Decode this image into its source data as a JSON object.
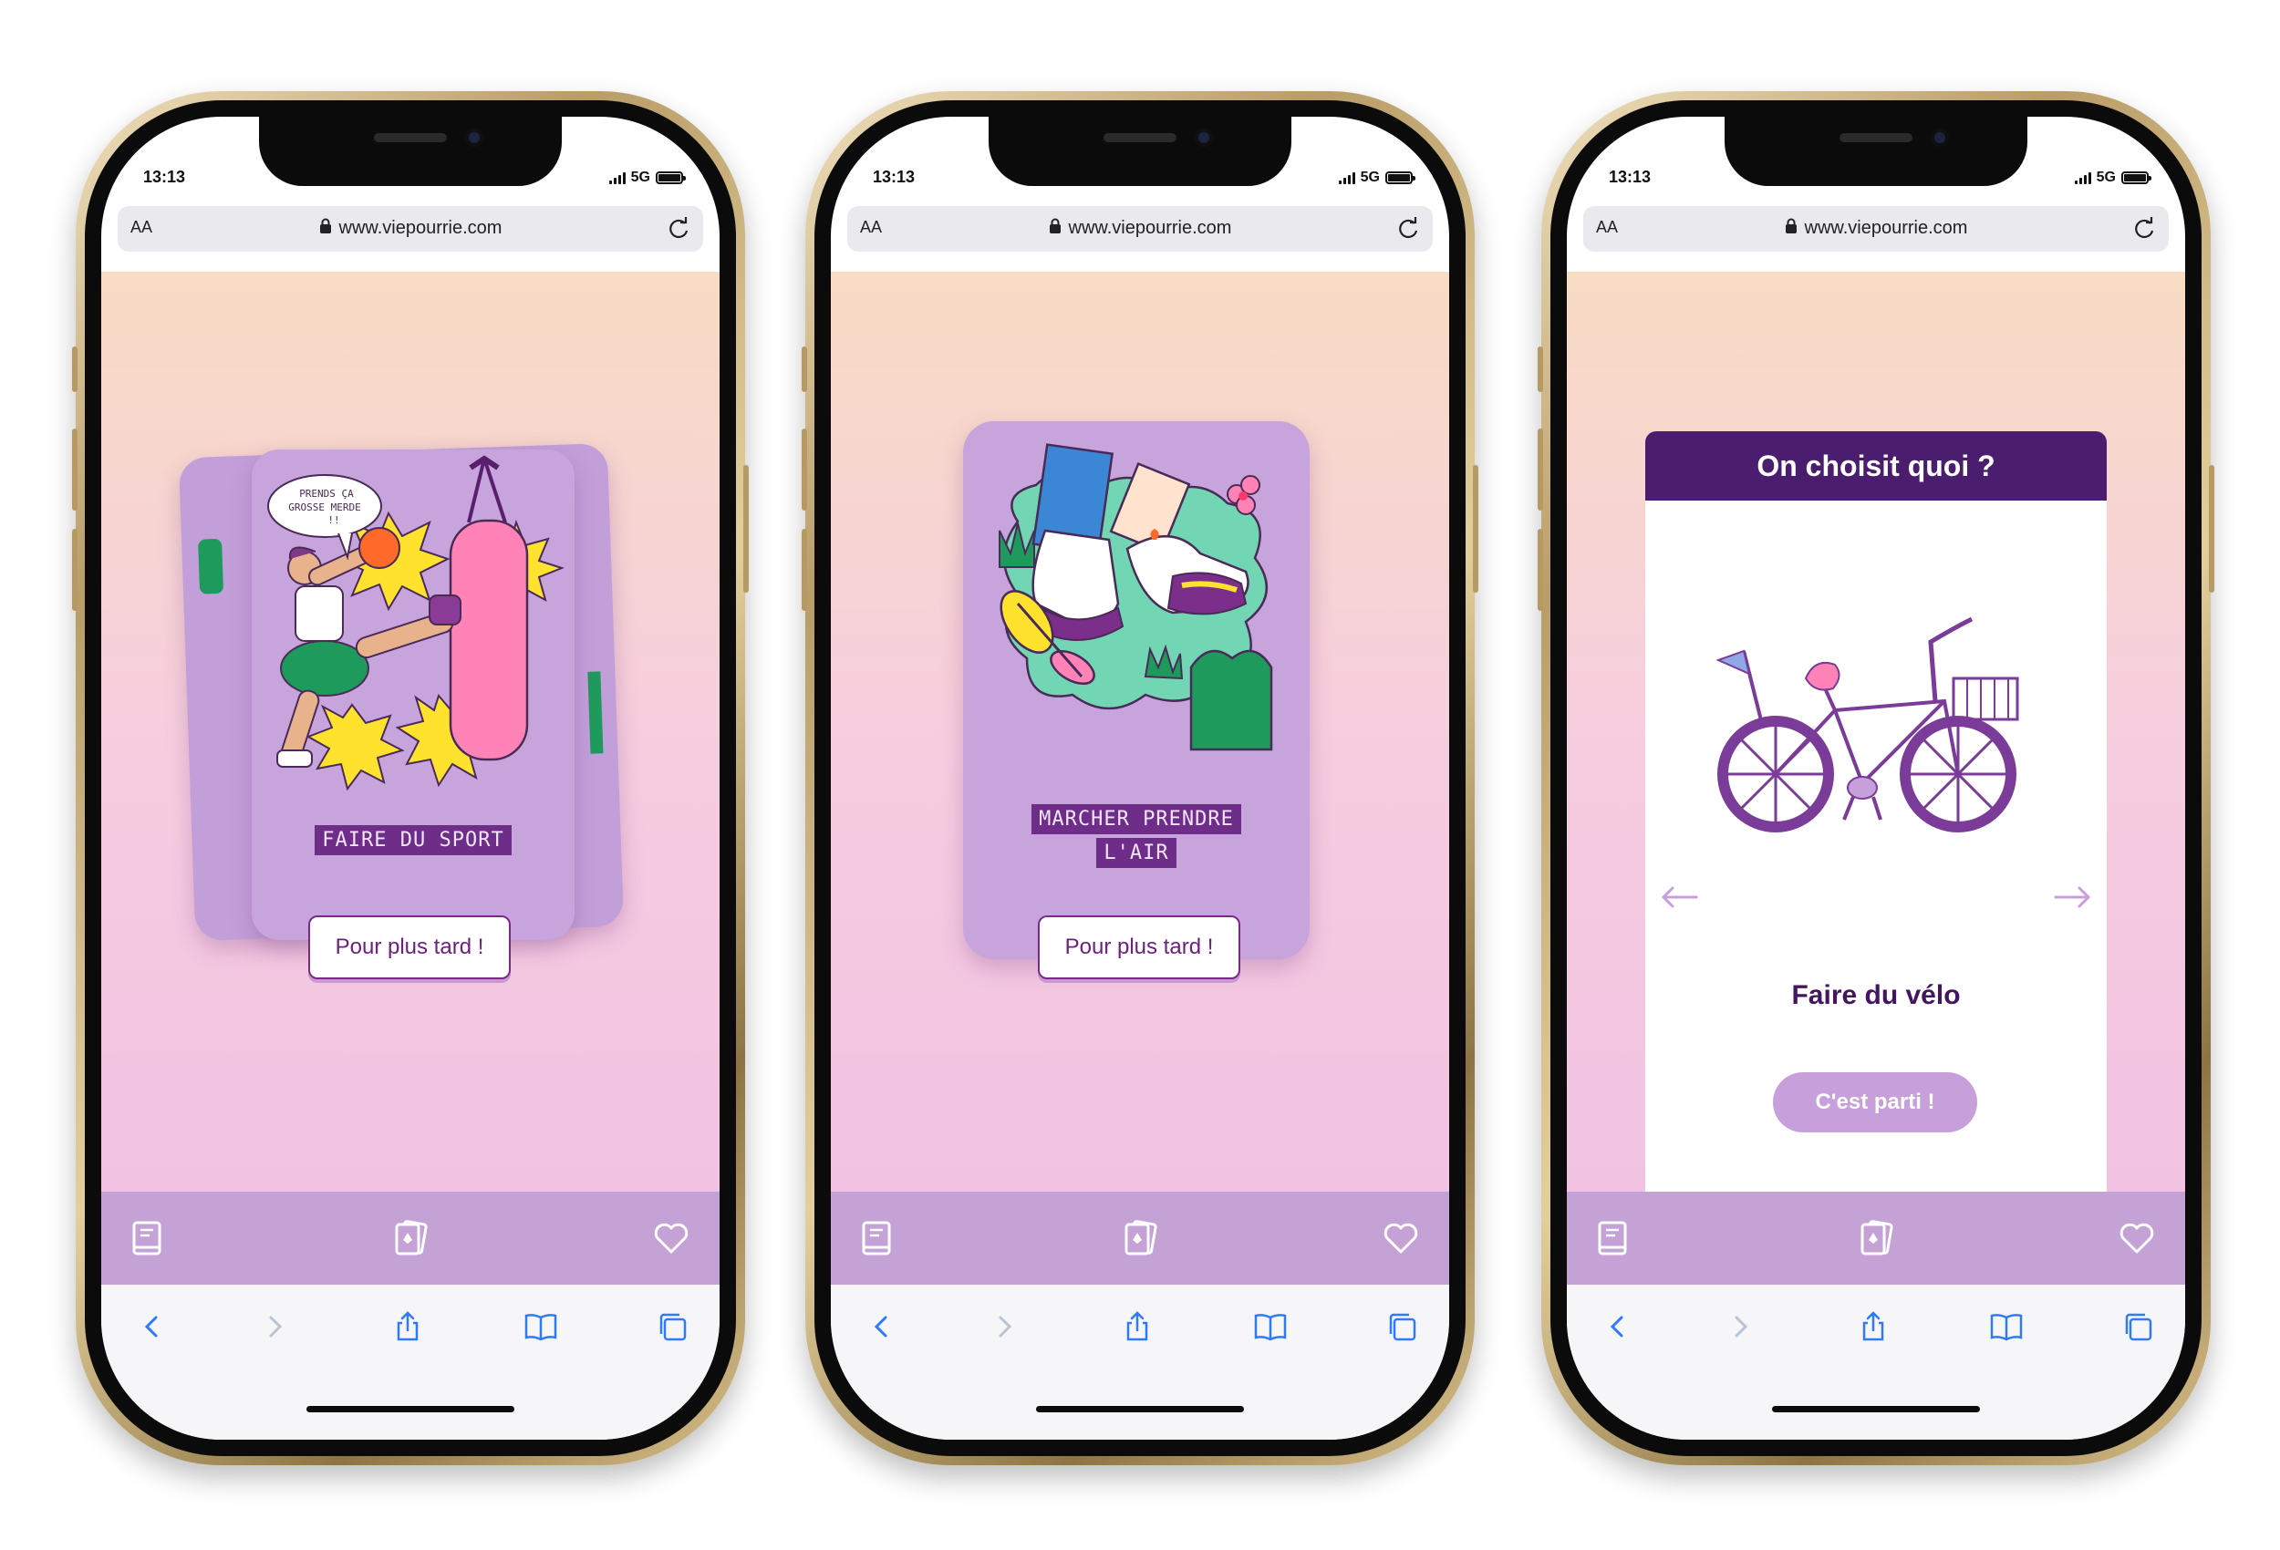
{
  "status_bar": {
    "time": "13:13",
    "network": "5G"
  },
  "browser": {
    "text_size_button": "AA",
    "url": "www.viepourrie.com"
  },
  "screens": [
    {
      "card_label_lines": [
        "FAIRE DU SPORT"
      ],
      "speech_bubble": [
        "PRENDS ÇA",
        "GROSSE MERDE",
        "!!"
      ],
      "later_button": "Pour plus tard !"
    },
    {
      "card_label_lines": [
        "MARCHER PRENDRE",
        "L'AIR"
      ],
      "later_button": "Pour plus tard !"
    },
    {
      "modal_title": "On choisit quoi ?",
      "activity_name": "Faire du vélo",
      "go_button": "C'est parti !"
    }
  ],
  "app_nav": {
    "icons": [
      "book-icon",
      "cards-icon",
      "heart-icon"
    ]
  },
  "safari_toolbar": {
    "icons": [
      "back-icon",
      "forward-icon",
      "share-icon",
      "bookmarks-icon",
      "tabs-icon"
    ]
  },
  "colors": {
    "accent_dark": "#4b1d6e",
    "accent": "#6e2d88",
    "card": "#c7a4dc",
    "nav": "#c4a2d6",
    "button_pastel": "#c79fdb"
  }
}
